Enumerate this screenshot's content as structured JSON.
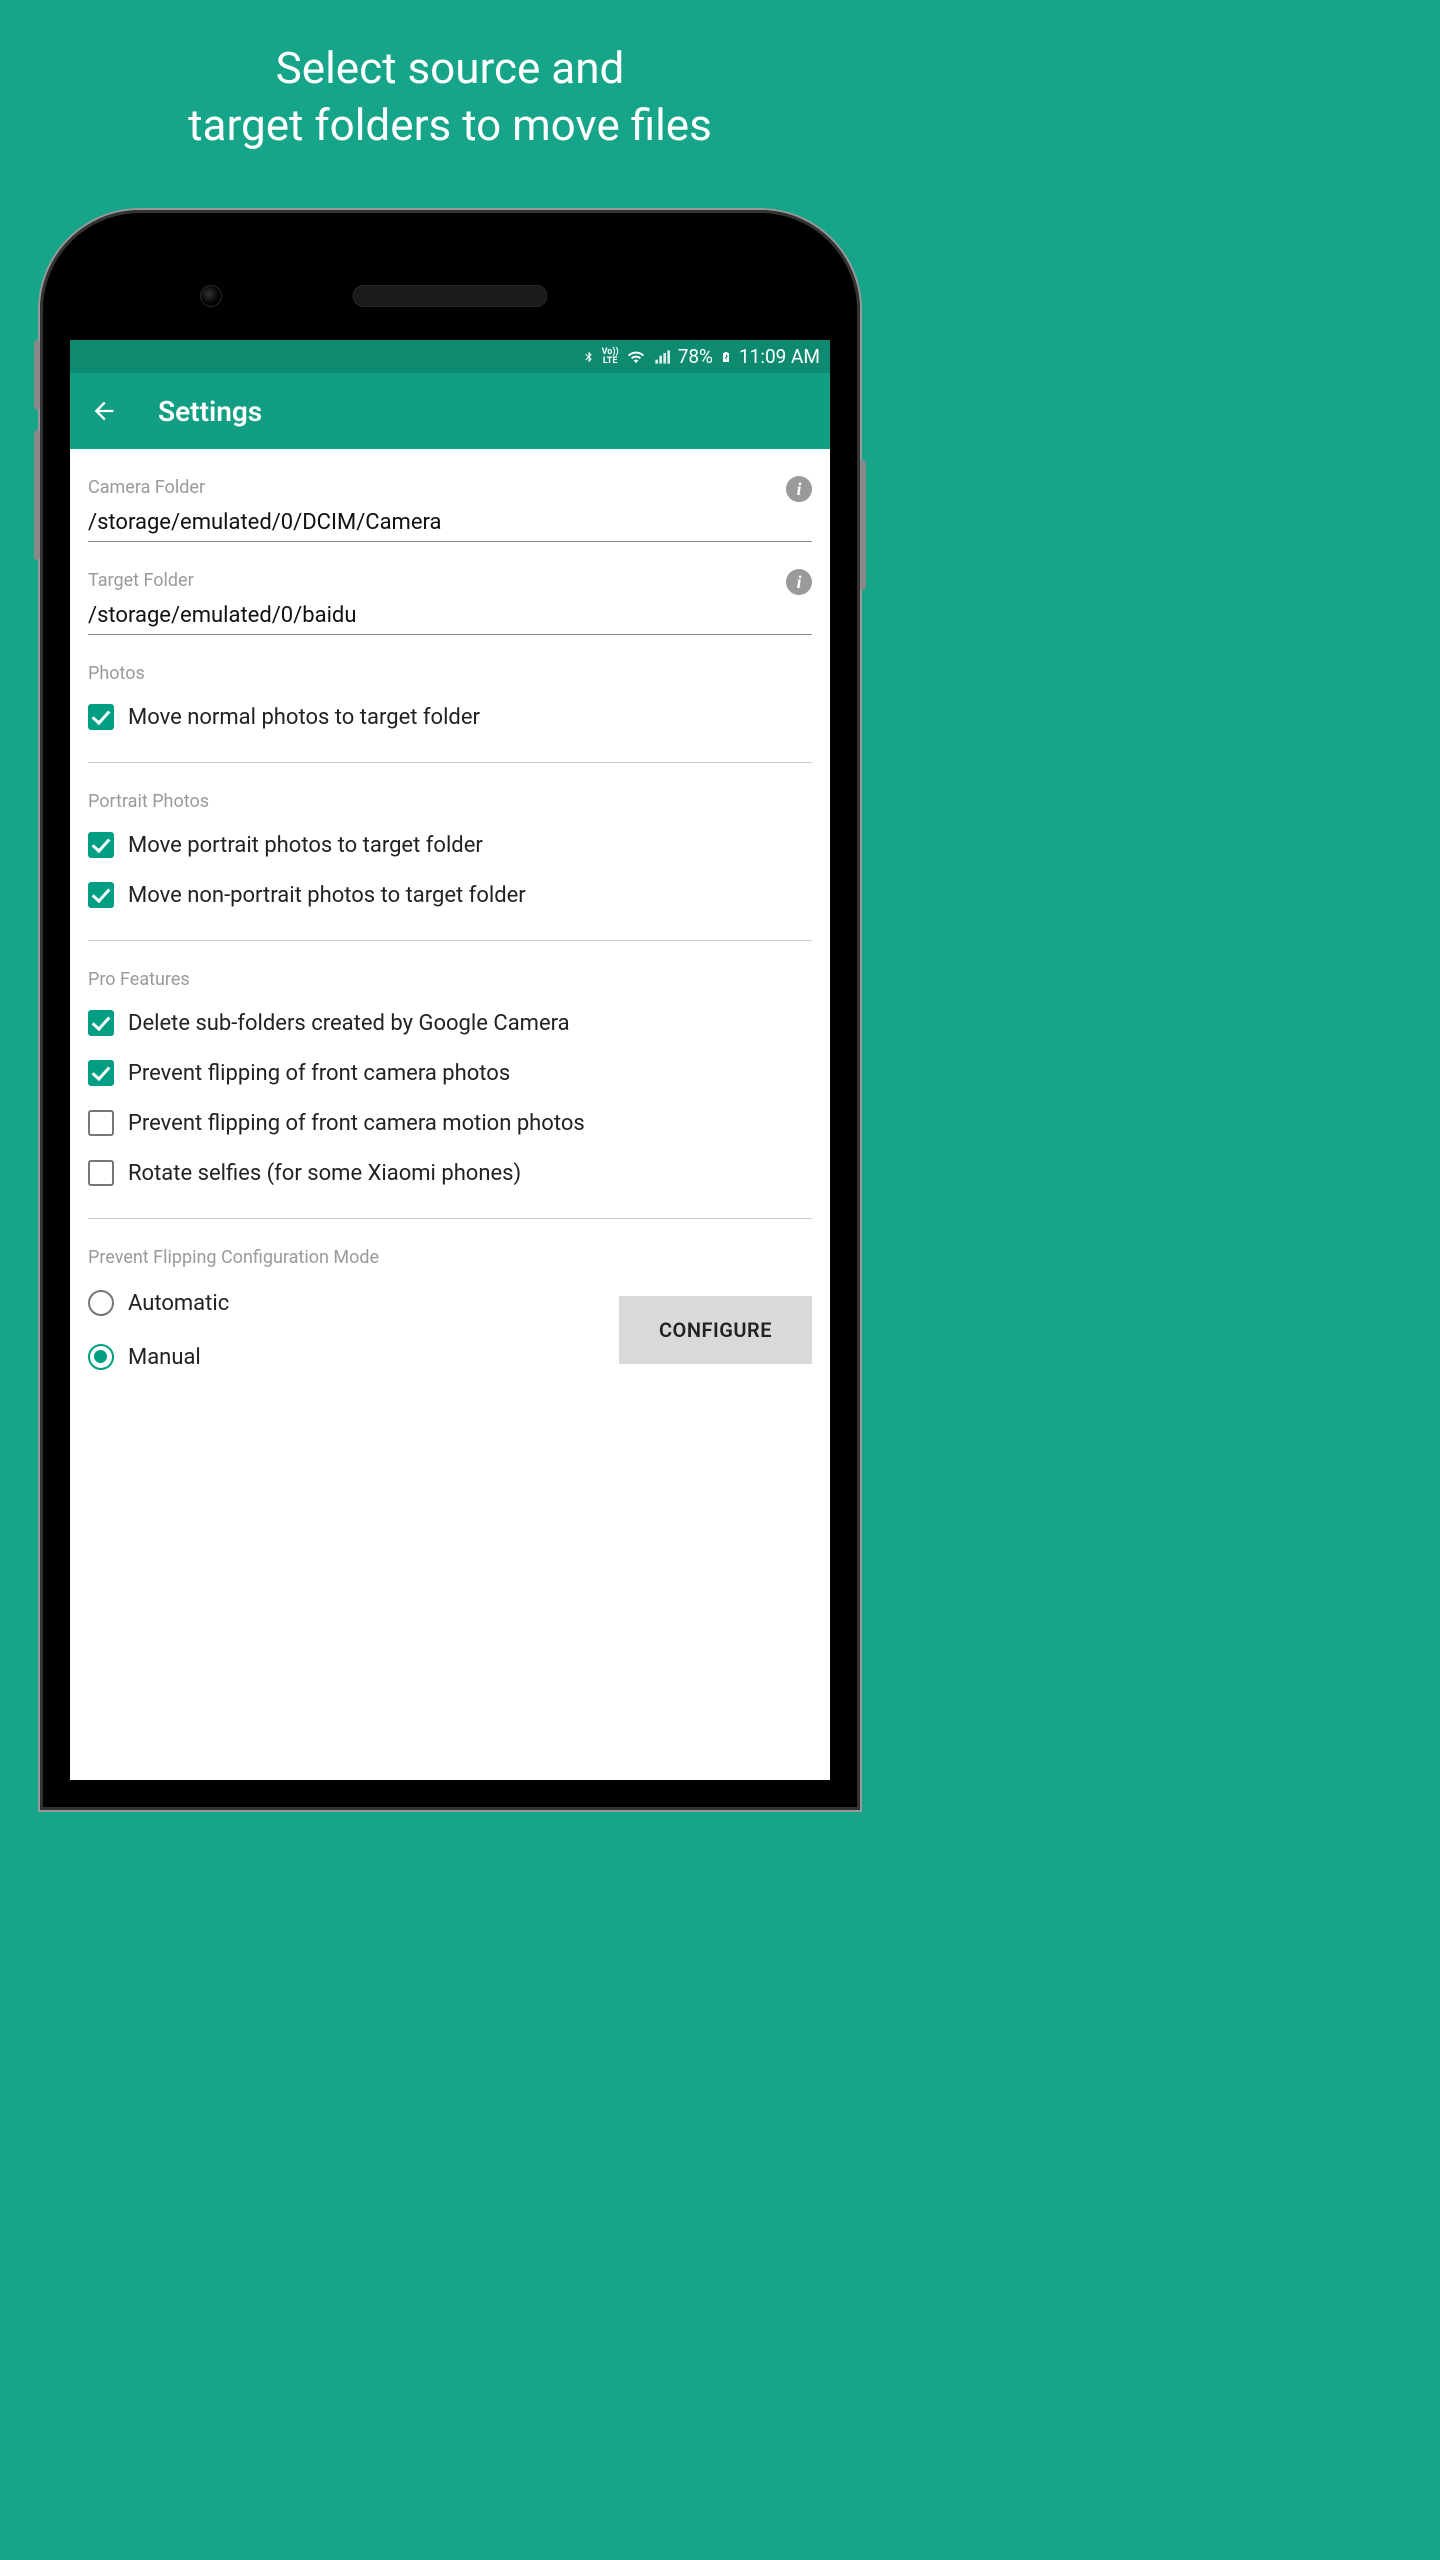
{
  "promo": {
    "line1": "Select source and",
    "line2": "target folders to move files"
  },
  "status": {
    "battery_pct": "78%",
    "time": "11:09 AM"
  },
  "appbar": {
    "title": "Settings"
  },
  "fields": {
    "camera": {
      "label": "Camera Folder",
      "value": "/storage/emulated/0/DCIM/Camera"
    },
    "target": {
      "label": "Target Folder",
      "value": "/storage/emulated/0/baidu"
    }
  },
  "sections": {
    "photos": {
      "label": "Photos",
      "items": [
        {
          "label": "Move normal photos to target folder",
          "checked": true
        }
      ]
    },
    "portrait": {
      "label": "Portrait Photos",
      "items": [
        {
          "label": "Move portrait photos to target folder",
          "checked": true
        },
        {
          "label": "Move non-portrait photos to target folder",
          "checked": true
        }
      ]
    },
    "pro": {
      "label": "Pro Features",
      "items": [
        {
          "label": "Delete sub-folders created by Google Camera",
          "checked": true
        },
        {
          "label": "Prevent flipping of front camera photos",
          "checked": true
        },
        {
          "label": "Prevent flipping of front camera motion photos",
          "checked": false
        },
        {
          "label": "Rotate selfies (for some Xiaomi phones)",
          "checked": false
        }
      ]
    },
    "mode": {
      "label": "Prevent Flipping Configuration Mode",
      "options": [
        {
          "label": "Automatic",
          "selected": false
        },
        {
          "label": "Manual",
          "selected": true
        }
      ],
      "button": "CONFIGURE"
    }
  }
}
